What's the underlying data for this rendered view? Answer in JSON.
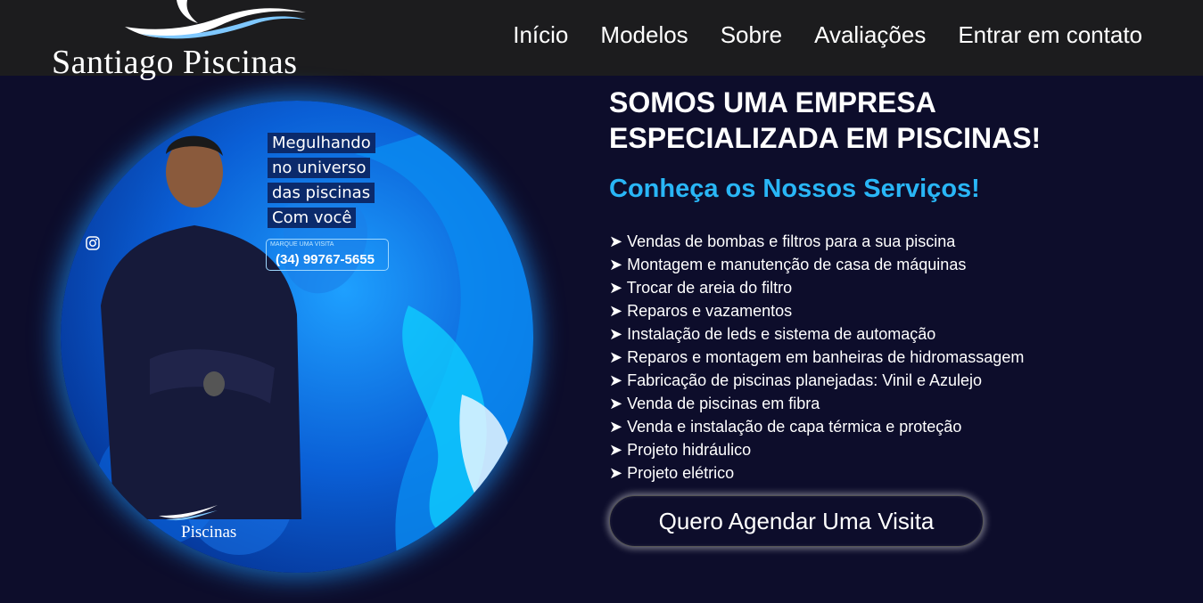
{
  "header": {
    "brand": "Santiago Piscinas",
    "nav": [
      "Início",
      "Modelos",
      "Sobre",
      "Avaliações",
      "Entrar em contato"
    ]
  },
  "hero_image": {
    "promo_lines": [
      "Megulhando",
      "no universo",
      "das piscinas",
      "Com você"
    ],
    "cta_small": "MARQUE UMA VISITA",
    "phone": "(34) 99767-5655",
    "brand": "Piscinas"
  },
  "hero": {
    "title": "SOMOS UMA EMPRESA ESPECIALIZADA EM PISCINAS!",
    "subtitle": "Conheça os Nossos Serviços!",
    "services": [
      "➤ Vendas de bombas e filtros para a sua piscina",
      "➤ Montagem e manutenção de casa de máquinas",
      "➤ Trocar de areia do filtro",
      "➤ Reparos e vazamentos",
      "➤ Instalação de leds e sistema de automação",
      "➤ Reparos e montagem em banheiras de hidromassagem",
      "➤ Fabricação de piscinas planejadas: Vinil e Azulejo",
      "➤ Venda de piscinas em fibra",
      "➤ Venda e instalação de capa térmica e proteção",
      "➤ Projeto hidráulico",
      "➤ Projeto elétrico"
    ],
    "cta_label": "Quero Agendar Uma Visita"
  },
  "colors": {
    "background": "#0d0d2b",
    "header": "#1c1c1e",
    "accent": "#29b6f6",
    "glow": "#1e96ff"
  },
  "icons": [
    "logo-wave-icon",
    "instagram-icon"
  ]
}
